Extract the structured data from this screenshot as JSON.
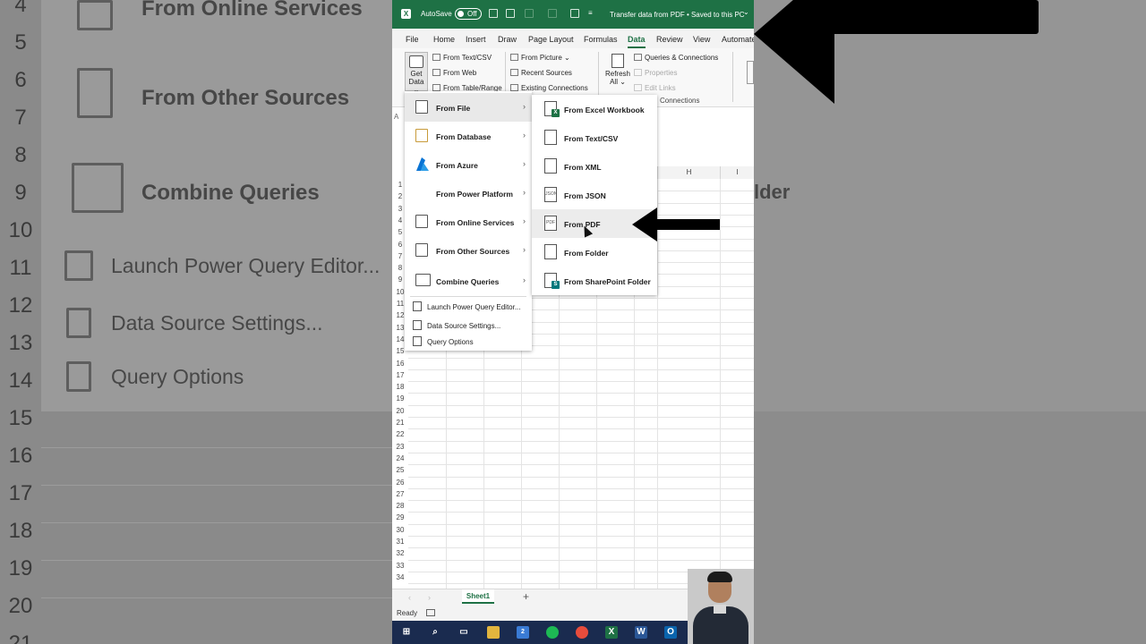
{
  "background_zoom": {
    "row_numbers": [
      "4",
      "5",
      "6",
      "7",
      "8",
      "9",
      "10",
      "11",
      "12",
      "13",
      "14",
      "15",
      "16",
      "17",
      "18",
      "19",
      "20",
      "21"
    ],
    "items": {
      "online": "From Online Services",
      "other": "From Other Sources",
      "combine": "Combine Queries",
      "launch": "Launch Power Query Editor...",
      "settings": "Data Source Settings...",
      "options": "Query Options",
      "folder_partial": "lder"
    }
  },
  "titlebar": {
    "app_icon": "excel-icon",
    "autosave_label": "AutoSave",
    "toggle_state": "Off",
    "doc_title": "Transfer data from PDF • Saved to this PC",
    "caret": "⌄"
  },
  "tabs": [
    "File",
    "Home",
    "Insert",
    "Draw",
    "Page Layout",
    "Formulas",
    "Data",
    "Review",
    "View",
    "Automate"
  ],
  "active_tab": "Data",
  "ribbon": {
    "get_data_line1": "Get",
    "get_data_line2": "Data ⌄",
    "from_text_csv": "From Text/CSV",
    "from_web": "From Web",
    "from_table_range": "From Table/Range",
    "from_picture": "From Picture ⌄",
    "recent_sources": "Recent Sources",
    "existing_connections": "Existing Connections",
    "refresh_line1": "Refresh",
    "refresh_line2": "All ⌄",
    "queries_connections": "Queries & Connections",
    "properties": "Properties",
    "edit_links": "Edit Links",
    "group_label": "Connections"
  },
  "grid": {
    "namebox": "A",
    "col_h": "H",
    "col_i": "I",
    "rows": [
      "1",
      "2",
      "3",
      "4",
      "5",
      "6",
      "7",
      "8",
      "9",
      "10",
      "11",
      "12",
      "13",
      "14",
      "15",
      "16",
      "17",
      "18",
      "19",
      "20",
      "21",
      "22",
      "23",
      "24",
      "25",
      "26",
      "27",
      "28",
      "29",
      "30",
      "31",
      "32",
      "33",
      "34"
    ]
  },
  "get_data_menu": {
    "items": [
      {
        "label": "From File",
        "arrow": "›",
        "icon": "file-icon"
      },
      {
        "label": "From Database",
        "arrow": "›",
        "icon": "database-icon"
      },
      {
        "label": "From Azure",
        "arrow": "›",
        "icon": "azure-icon"
      },
      {
        "label": "From Power Platform",
        "arrow": "›",
        "icon": "power-platform-icon"
      },
      {
        "label": "From Online Services",
        "arrow": "›",
        "icon": "online-services-icon"
      },
      {
        "label": "From Other Sources",
        "arrow": "›",
        "icon": "other-sources-icon"
      },
      {
        "label": "Combine Queries",
        "arrow": "›",
        "icon": "table-icon"
      }
    ],
    "small_items": [
      {
        "label": "Launch Power Query Editor...",
        "icon": "power-query-icon"
      },
      {
        "label": "Data Source Settings...",
        "icon": "settings-icon"
      },
      {
        "label": "Query Options",
        "icon": "options-icon"
      }
    ]
  },
  "from_file_submenu": {
    "items": [
      {
        "label": "From Excel Workbook",
        "icon": "excel-workbook-icon",
        "badge": "X",
        "badge_color": "#1e7145"
      },
      {
        "label": "From Text/CSV",
        "icon": "text-file-icon"
      },
      {
        "label": "From XML",
        "icon": "xml-icon"
      },
      {
        "label": "From JSON",
        "icon": "json-icon",
        "icon_text": "JSON"
      },
      {
        "label": "From PDF",
        "icon": "pdf-icon",
        "icon_text": "PDF"
      },
      {
        "label": "From Folder",
        "icon": "folder-icon"
      },
      {
        "label": "From SharePoint Folder",
        "icon": "sharepoint-icon",
        "badge": "S",
        "badge_color": "#03787c"
      }
    ],
    "hovered": "From PDF"
  },
  "sheetbar": {
    "nav_prev": "‹",
    "nav_next": "›",
    "sheet_tab": "Sheet1",
    "add": "+"
  },
  "status": {
    "ready": "Ready"
  },
  "taskbar_glyphs": {
    "start": "⊞",
    "search": "⌕",
    "taskview": "▭",
    "excel": "X",
    "word": "W",
    "outlook": "O",
    "teams_badge": "2"
  },
  "colors": {
    "excel_green": "#1e7145",
    "taskbar": "#1a2b4f",
    "arrow": "#000000"
  }
}
